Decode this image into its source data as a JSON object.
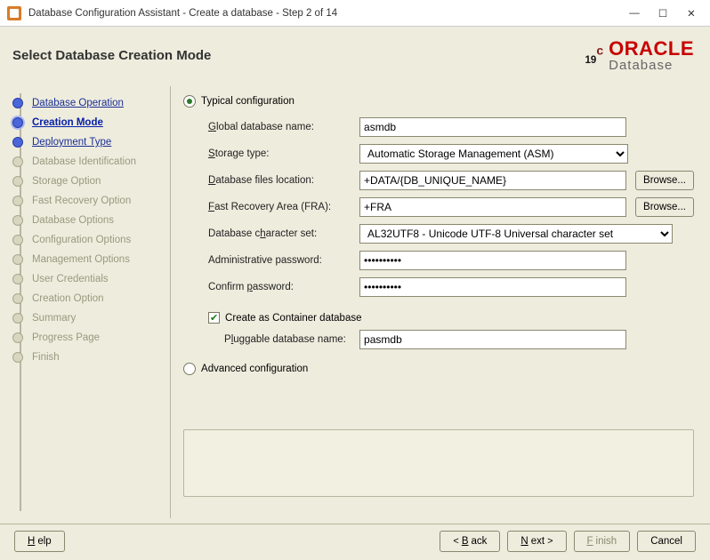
{
  "window": {
    "title": "Database Configuration Assistant - Create a database - Step 2 of 14"
  },
  "page_title": "Select Database Creation Mode",
  "brand": {
    "version": "19",
    "versup": "c",
    "name": "ORACLE",
    "sub": "Database"
  },
  "steps": [
    {
      "label": "Database Operation",
      "state": "done"
    },
    {
      "label": "Creation Mode",
      "state": "current"
    },
    {
      "label": "Deployment Type",
      "state": "done"
    },
    {
      "label": "Database Identification",
      "state": "pending"
    },
    {
      "label": "Storage Option",
      "state": "pending"
    },
    {
      "label": "Fast Recovery Option",
      "state": "pending"
    },
    {
      "label": "Database Options",
      "state": "pending"
    },
    {
      "label": "Configuration Options",
      "state": "pending"
    },
    {
      "label": "Management Options",
      "state": "pending"
    },
    {
      "label": "User Credentials",
      "state": "pending"
    },
    {
      "label": "Creation Option",
      "state": "pending"
    },
    {
      "label": "Summary",
      "state": "pending"
    },
    {
      "label": "Progress Page",
      "state": "pending"
    },
    {
      "label": "Finish",
      "state": "pending"
    }
  ],
  "radios": {
    "typical": "Typical configuration",
    "advanced": "Advanced configuration"
  },
  "form": {
    "global_db_label": "Global database name:",
    "global_db_value": "asmdb",
    "storage_label": "Storage type:",
    "storage_value": "Automatic Storage Management (ASM)",
    "files_label": "Database files location:",
    "files_value": "+DATA/{DB_UNIQUE_NAME}",
    "fra_label": "Fast Recovery Area (FRA):",
    "fra_value": "+FRA",
    "charset_label": "Database character set:",
    "charset_value": "AL32UTF8 - Unicode UTF-8 Universal character set",
    "admin_label": "Administrative password:",
    "admin_value": "••••••••••",
    "confirm_label": "Confirm password:",
    "confirm_value": "••••••••••",
    "browse": "Browse...",
    "container_label": "Create as Container database",
    "pdb_label": "Pluggable database name:",
    "pdb_value": "pasmdb"
  },
  "footer": {
    "help": "Help",
    "back": "Back",
    "next": "Next",
    "finish": "Finish",
    "cancel": "Cancel"
  }
}
